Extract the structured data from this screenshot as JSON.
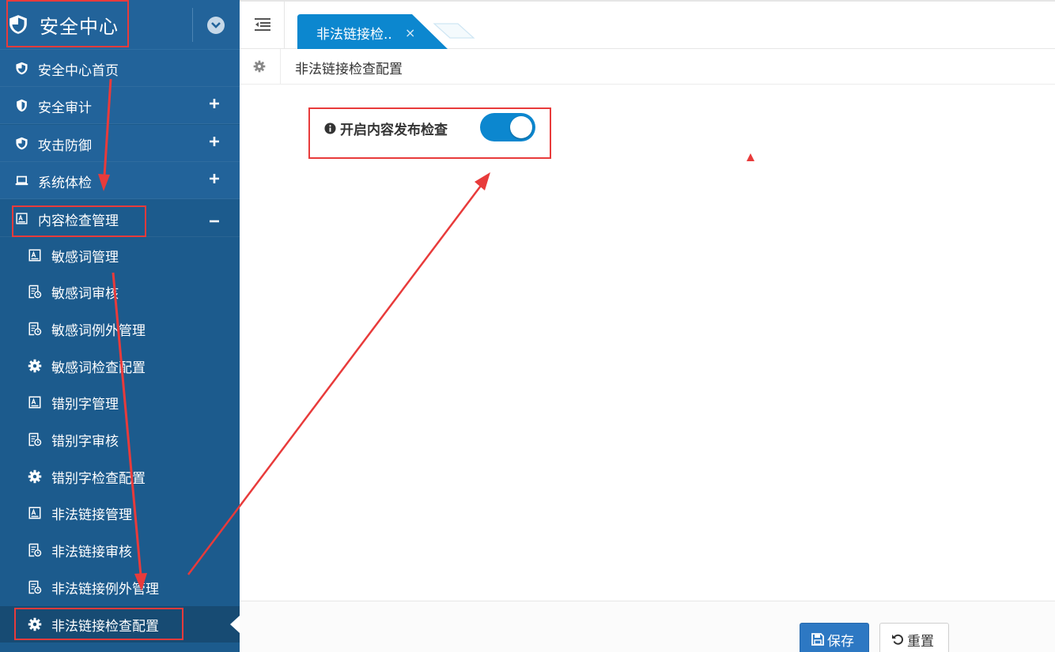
{
  "app": {
    "title": "安全中心"
  },
  "sidebar": {
    "items": [
      {
        "label": "安全中心首页",
        "icon": "shield-icon",
        "expander": ""
      },
      {
        "label": "安全审计",
        "icon": "shield-half-icon",
        "expander": "plus"
      },
      {
        "label": "攻击防御",
        "icon": "shield-icon",
        "expander": "plus"
      },
      {
        "label": "系统体检",
        "icon": "laptop-icon",
        "expander": "plus"
      },
      {
        "label": "内容检查管理",
        "icon": "document-a-icon",
        "expander": "minus"
      }
    ],
    "sub_items": [
      {
        "label": "敏感词管理",
        "icon": "document-a-icon"
      },
      {
        "label": "敏感词审核",
        "icon": "document-clock-icon"
      },
      {
        "label": "敏感词例外管理",
        "icon": "document-clock-icon"
      },
      {
        "label": "敏感词检查配置",
        "icon": "gear-icon"
      },
      {
        "label": "错别字管理",
        "icon": "document-a-icon"
      },
      {
        "label": "错别字审核",
        "icon": "document-clock-icon"
      },
      {
        "label": "错别字检查配置",
        "icon": "gear-icon"
      },
      {
        "label": "非法链接管理",
        "icon": "document-a-icon"
      },
      {
        "label": "非法链接审核",
        "icon": "document-clock-icon"
      },
      {
        "label": "非法链接例外管理",
        "icon": "document-clock-icon"
      },
      {
        "label": "非法链接检查配置",
        "icon": "gear-icon",
        "active": true
      }
    ]
  },
  "tabs": [
    {
      "label": "非法链接检..",
      "close": "×",
      "active": true
    }
  ],
  "breadcrumb": {
    "text": "非法链接检查配置"
  },
  "form": {
    "field_label": "开启内容发布检查",
    "toggle_on": true
  },
  "footer": {
    "save_label": "保存",
    "reset_label": "重置"
  },
  "colors": {
    "sidebar_bg": "#1c5b8d",
    "accent": "#0c87cf",
    "annotation": "#e83b3b"
  }
}
